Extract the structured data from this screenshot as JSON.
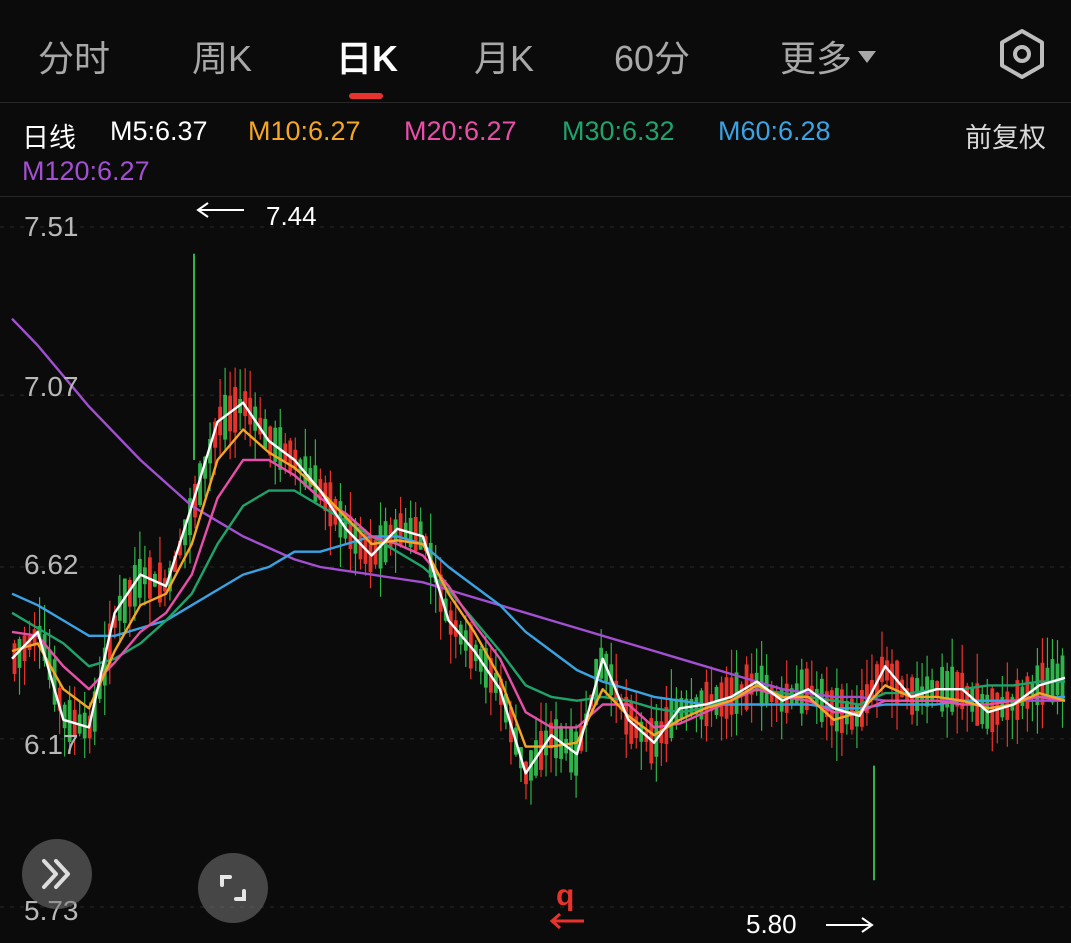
{
  "tabs": [
    {
      "label": "分时"
    },
    {
      "label": "周K"
    },
    {
      "label": "日K",
      "active": true
    },
    {
      "label": "月K"
    },
    {
      "label": "60分"
    },
    {
      "label": "更多"
    }
  ],
  "settings_icon": "gear-icon",
  "ma_legend": {
    "period": "日线",
    "items": [
      {
        "label": "M5:6.37",
        "color": "#ffffff"
      },
      {
        "label": "M10:6.27",
        "color": "#f5a623"
      },
      {
        "label": "M20:6.27",
        "color": "#e84fa8"
      },
      {
        "label": "M30:6.32",
        "color": "#1fa36b"
      },
      {
        "label": "M60:6.28",
        "color": "#3aa3e3"
      },
      {
        "label": "M120:6.27",
        "color": "#a24fd1"
      }
    ],
    "adjust": "前复权"
  },
  "chart_data": {
    "type": "candlestick",
    "y_ticks": [
      "7.51",
      "7.07",
      "6.62",
      "6.17",
      "5.73"
    ],
    "ylim": [
      5.73,
      7.51
    ],
    "max_price_marker": "7.44",
    "min_price_marker": "5.80",
    "up_color": "#e8332c",
    "down_color": "#2fb34a",
    "ma5": [
      6.38,
      6.45,
      6.22,
      6.2,
      6.5,
      6.6,
      6.57,
      6.78,
      7.0,
      7.05,
      6.95,
      6.9,
      6.82,
      6.72,
      6.65,
      6.72,
      6.7,
      6.48,
      6.4,
      6.3,
      6.08,
      6.18,
      6.13,
      6.38,
      6.22,
      6.16,
      6.25,
      6.26,
      6.28,
      6.32,
      6.27,
      6.3,
      6.25,
      6.23,
      6.36,
      6.28,
      6.3,
      6.3,
      6.24,
      6.26,
      6.31,
      6.33
    ],
    "ma10": [
      6.4,
      6.42,
      6.3,
      6.25,
      6.4,
      6.52,
      6.55,
      6.68,
      6.9,
      6.98,
      6.92,
      6.88,
      6.82,
      6.75,
      6.68,
      6.69,
      6.68,
      6.55,
      6.45,
      6.33,
      6.15,
      6.15,
      6.16,
      6.3,
      6.23,
      6.18,
      6.22,
      6.25,
      6.27,
      6.31,
      6.28,
      6.28,
      6.22,
      6.24,
      6.31,
      6.28,
      6.28,
      6.27,
      6.25,
      6.26,
      6.29,
      6.27
    ],
    "ma20": [
      6.45,
      6.44,
      6.36,
      6.3,
      6.37,
      6.45,
      6.5,
      6.6,
      6.8,
      6.9,
      6.9,
      6.86,
      6.8,
      6.76,
      6.7,
      6.68,
      6.65,
      6.57,
      6.47,
      6.38,
      6.24,
      6.2,
      6.2,
      6.26,
      6.26,
      6.2,
      6.21,
      6.24,
      6.27,
      6.3,
      6.28,
      6.27,
      6.24,
      6.24,
      6.27,
      6.27,
      6.27,
      6.26,
      6.26,
      6.27,
      6.28,
      6.27
    ],
    "ma30": [
      6.5,
      6.46,
      6.42,
      6.36,
      6.38,
      6.42,
      6.48,
      6.55,
      6.68,
      6.78,
      6.82,
      6.82,
      6.78,
      6.74,
      6.7,
      6.66,
      6.62,
      6.56,
      6.48,
      6.4,
      6.31,
      6.28,
      6.27,
      6.28,
      6.27,
      6.25,
      6.24,
      6.25,
      6.28,
      6.3,
      6.29,
      6.28,
      6.27,
      6.26,
      6.29,
      6.29,
      6.3,
      6.3,
      6.31,
      6.31,
      6.32,
      6.32
    ],
    "ma60": [
      6.55,
      6.52,
      6.48,
      6.44,
      6.44,
      6.46,
      6.48,
      6.52,
      6.56,
      6.6,
      6.62,
      6.66,
      6.66,
      6.68,
      6.7,
      6.7,
      6.68,
      6.62,
      6.57,
      6.52,
      6.45,
      6.4,
      6.35,
      6.32,
      6.3,
      6.28,
      6.27,
      6.26,
      6.26,
      6.26,
      6.26,
      6.26,
      6.25,
      6.25,
      6.26,
      6.26,
      6.26,
      6.27,
      6.27,
      6.27,
      6.28,
      6.28
    ],
    "ma120": [
      7.27,
      7.2,
      7.12,
      7.04,
      6.97,
      6.9,
      6.84,
      6.78,
      6.74,
      6.7,
      6.67,
      6.64,
      6.62,
      6.61,
      6.6,
      6.59,
      6.58,
      6.56,
      6.54,
      6.52,
      6.5,
      6.48,
      6.46,
      6.44,
      6.42,
      6.4,
      6.38,
      6.36,
      6.34,
      6.32,
      6.3,
      6.29,
      6.28,
      6.28,
      6.27,
      6.27,
      6.27,
      6.27,
      6.27,
      6.27,
      6.27,
      6.27
    ]
  },
  "controls": {
    "expand_icon": "double-chevron-right-icon",
    "fullscreen_icon": "fullscreen-icon",
    "range_marker": "q"
  }
}
